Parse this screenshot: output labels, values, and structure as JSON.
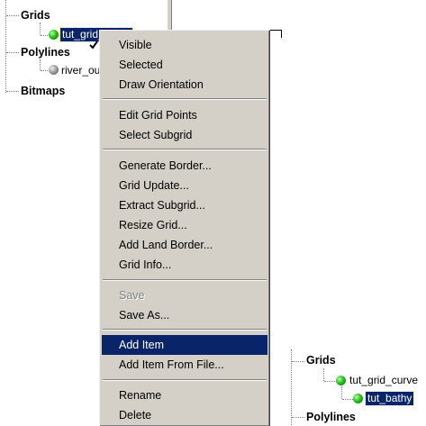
{
  "tree_top": {
    "grids_label": "Grids",
    "grid_item": "tut_grid_curve",
    "polylines_label": "Polylines",
    "polyline_item": "river_ou",
    "bitmaps_label": "Bitmaps"
  },
  "context_menu": {
    "items": [
      {
        "label": "Visible"
      },
      {
        "label": "Selected"
      },
      {
        "label": "Draw Orientation"
      },
      {
        "label": "Edit Grid Points"
      },
      {
        "label": "Select Subgrid"
      },
      {
        "label": "Generate Border..."
      },
      {
        "label": "Grid Update..."
      },
      {
        "label": "Extract Subgrid..."
      },
      {
        "label": "Resize Grid..."
      },
      {
        "label": "Add Land Border..."
      },
      {
        "label": "Grid Info..."
      },
      {
        "label": "Save"
      },
      {
        "label": "Save As..."
      },
      {
        "label": "Add Item"
      },
      {
        "label": "Add Item From File..."
      },
      {
        "label": "Rename"
      },
      {
        "label": "Delete"
      }
    ]
  },
  "tree_bottom": {
    "grids_label": "Grids",
    "grid_item": "tut_grid_curve",
    "child_item": "tut_bathy",
    "polylines_label": "Polylines"
  },
  "colors": {
    "menu_bg": "#d4d0c8",
    "highlight": "#0a246a",
    "ball_green": "#27c21c"
  }
}
